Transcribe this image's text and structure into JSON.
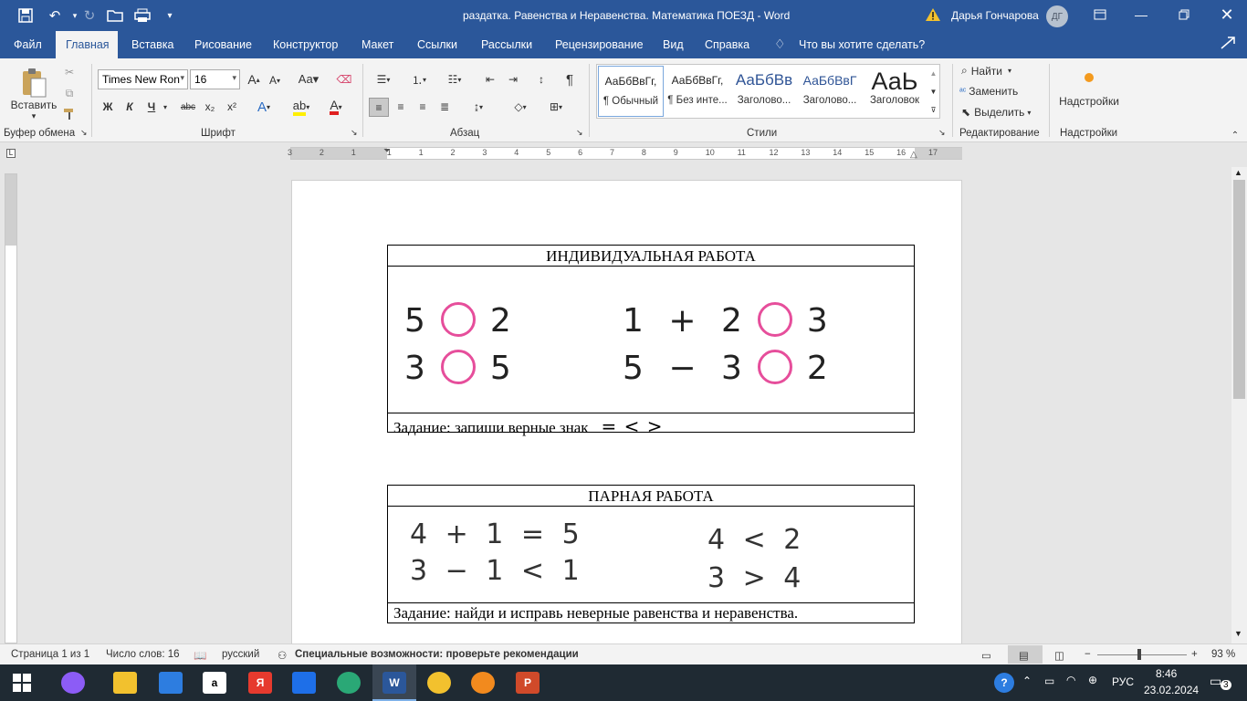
{
  "window": {
    "doc_title": "раздатка. Равенства и Неравенства. Математика ПОЕЗД  -  Word",
    "user_name": "Дарья Гончарова",
    "user_initials": "ДГ"
  },
  "tabs": [
    "Файл",
    "Главная",
    "Вставка",
    "Рисование",
    "Конструктор",
    "Макет",
    "Ссылки",
    "Рассылки",
    "Рецензирование",
    "Вид",
    "Справка"
  ],
  "tell_me": "Что вы хотите сделать?",
  "ribbon": {
    "paste_label": "Вставить",
    "groups": {
      "clipboard": "Буфер обмена",
      "font": "Шрифт",
      "paragraph": "Абзац",
      "styles": "Стили",
      "editing": "Редактирование",
      "addins": "Надстройки"
    },
    "font_name": "Times New Ron",
    "font_size": "16",
    "format_buttons": {
      "bold": "Ж",
      "italic": "К",
      "underline": "Ч",
      "strike": "abc",
      "sub": "x₂",
      "sup": "x²"
    },
    "styles": [
      {
        "preview": "АаБбВвГг,",
        "name": "¶ Обычный"
      },
      {
        "preview": "АаБбВвГг,",
        "name": "¶ Без инте..."
      },
      {
        "preview": "АаБбВв",
        "name": "Заголово..."
      },
      {
        "preview": "АаБбВвГ",
        "name": "Заголово..."
      },
      {
        "preview": "АаЬ",
        "name": "Заголовок"
      }
    ],
    "editing": {
      "find": "Найти",
      "replace": "Заменить",
      "select": "Выделить"
    },
    "addins_button": "Надстройки"
  },
  "ruler_numbers": [
    "3",
    "2",
    "1",
    "1",
    "1",
    "2",
    "3",
    "4",
    "5",
    "6",
    "7",
    "8",
    "9",
    "10",
    "11",
    "12",
    "13",
    "14",
    "15",
    "16",
    "17"
  ],
  "document": {
    "table1": {
      "title": "ИНДИВИДУАЛЬНАЯ РАБОТА",
      "left_rows": [
        [
          "5",
          "2"
        ],
        [
          "3",
          "5"
        ]
      ],
      "right_rows": [
        [
          "1",
          "+",
          "2",
          "3"
        ],
        [
          "5",
          "−",
          "3",
          "2"
        ]
      ],
      "task": "Задание: запиши верные знак",
      "signs": "=  <  >"
    },
    "table2": {
      "title": "ПАРНАЯ РАБОТА",
      "left_rows": [
        "4  +  1  =  5",
        "3  −  1  <  1"
      ],
      "right_rows": [
        "4  <  2",
        "3  >  4"
      ],
      "task": "Задание: найди и исправь неверные равенства и неравенства."
    }
  },
  "statusbar": {
    "page": "Страница 1 из 1",
    "words": "Число слов: 16",
    "language": "русский",
    "accessibility": "Специальные возможности: проверьте рекомендации",
    "zoom": "93 %"
  },
  "taskbar": {
    "lang": "РУС",
    "time": "8:46",
    "date": "23.02.2024",
    "notif_count": "3"
  },
  "colors": {
    "accent": "#2b579a",
    "ring": "#e64e9b"
  }
}
